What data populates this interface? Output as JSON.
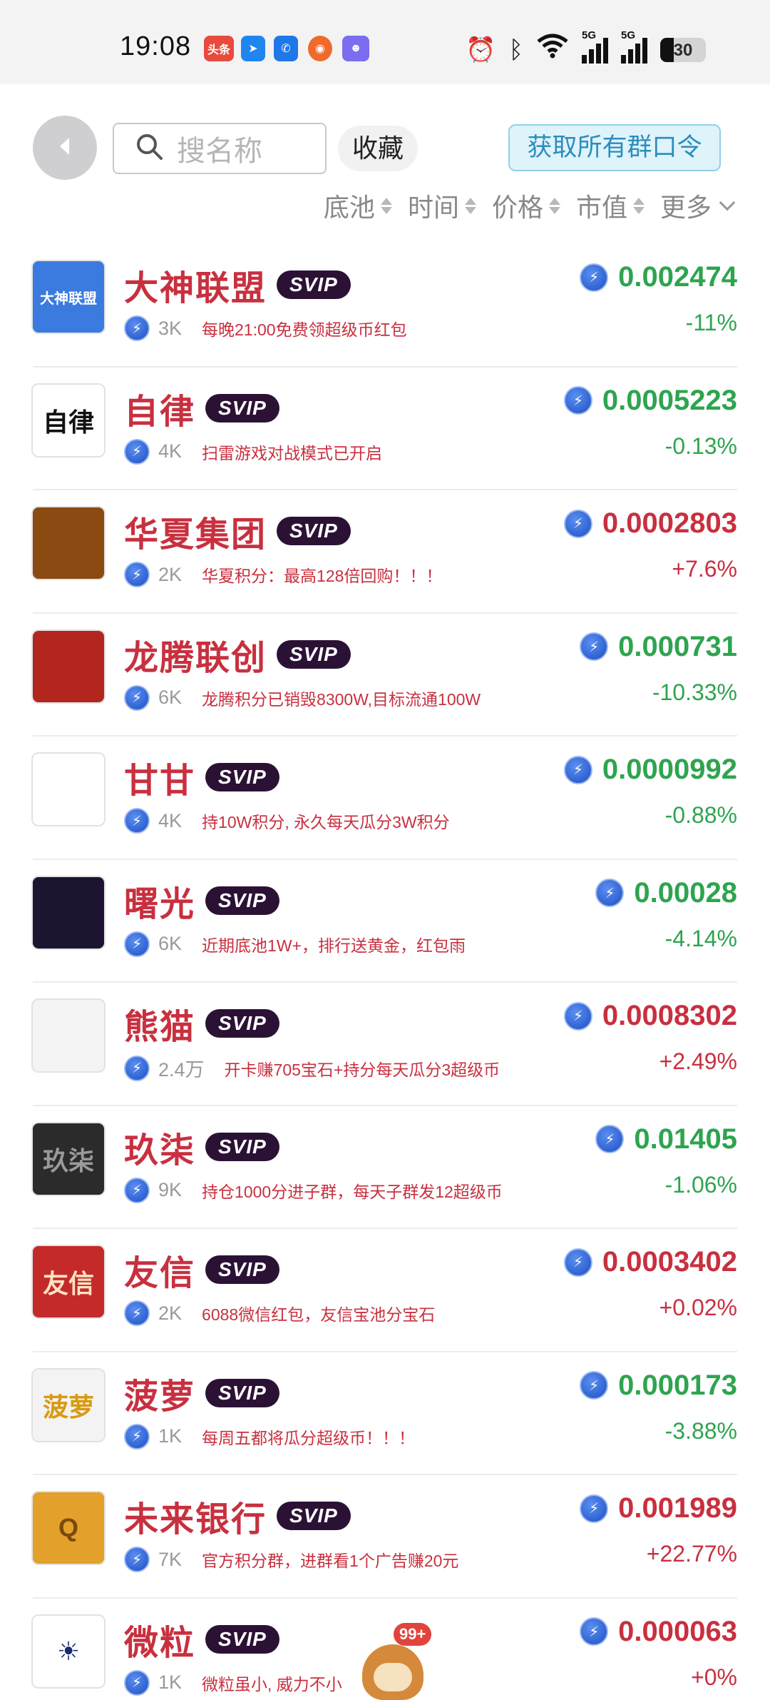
{
  "status_bar": {
    "time": "19:08",
    "apps": [
      {
        "name": "toutiao",
        "label": "头条",
        "color": "#e84a3c"
      },
      {
        "name": "arrow-app",
        "label": "",
        "color": "#1f86f0"
      },
      {
        "name": "phone-app",
        "label": "",
        "color": "#1f78e8"
      },
      {
        "name": "weibo-app",
        "label": "",
        "color": "#ef6a2b"
      },
      {
        "name": "mascot-app",
        "label": "",
        "color": "#7b6cf0"
      }
    ],
    "icons": [
      "alarm-icon",
      "bluetooth-icon",
      "wifi-icon"
    ],
    "signal_labels": [
      "5G",
      "5G"
    ],
    "battery": {
      "level": 0.3,
      "label": "30"
    }
  },
  "header": {
    "search_placeholder": "搜名称",
    "favorites_label": "收藏",
    "get_all_label": "获取所有群口令"
  },
  "sort": [
    {
      "label": "底池"
    },
    {
      "label": "时间"
    },
    {
      "label": "价格"
    },
    {
      "label": "市值"
    },
    {
      "label": "更多"
    }
  ],
  "svip_label": "SVIP",
  "groups": [
    {
      "name": "大神联盟",
      "members": "3K",
      "desc": "每晚21:00免费领超级币红包",
      "price": "0.002474",
      "change": "-11%",
      "trend": "down",
      "avatar_text": "大神联盟",
      "avatar_bg": "#3b7be0",
      "avatar_fg": "#ffffff"
    },
    {
      "name": "自律",
      "members": "4K",
      "desc": "扫雷游戏对战模式已开启",
      "price": "0.0005223",
      "change": "-0.13%",
      "trend": "down",
      "avatar_text": "自律",
      "avatar_bg": "#ffffff",
      "avatar_fg": "#111111"
    },
    {
      "name": "华夏集团",
      "members": "2K",
      "desc": "华夏积分：最高128倍回购！！！",
      "price": "0.0002803",
      "change": "+7.6%",
      "trend": "up",
      "avatar_text": "",
      "avatar_bg": "#8a4a12",
      "avatar_fg": "#ffd27a"
    },
    {
      "name": "龙腾联创",
      "members": "6K",
      "desc": "龙腾积分已销毁8300W,目标流通100W",
      "price": "0.000731",
      "change": "-10.33%",
      "trend": "down",
      "avatar_text": "",
      "avatar_bg": "#b3261e",
      "avatar_fg": "#f5c36b"
    },
    {
      "name": "甘甘",
      "members": "4K",
      "desc": "持10W积分, 永久每天瓜分3W积分",
      "price": "0.0000992",
      "change": "-0.88%",
      "trend": "down",
      "avatar_text": "",
      "avatar_bg": "#ffffff",
      "avatar_fg": "#9b4fe0"
    },
    {
      "name": "曙光",
      "members": "6K",
      "desc": "近期底池1W+，排行送黄金，红包雨",
      "price": "0.00028",
      "change": "-4.14%",
      "trend": "down",
      "avatar_text": "",
      "avatar_bg": "#1c1430",
      "avatar_fg": "#f3d16a"
    },
    {
      "name": "熊猫",
      "members": "2.4万",
      "desc": "开卡赚705宝石+持分每天瓜分3超级币",
      "price": "0.0008302",
      "change": "+2.49%",
      "trend": "up",
      "avatar_text": "",
      "avatar_bg": "#f4f4f4",
      "avatar_fg": "#111111"
    },
    {
      "name": "玖柒",
      "members": "9K",
      "desc": "持仓1000分进子群，每天子群发12超级币",
      "price": "0.01405",
      "change": "-1.06%",
      "trend": "down",
      "avatar_text": "玖柒",
      "avatar_bg": "#2b2b2b",
      "avatar_fg": "#9a9a9a"
    },
    {
      "name": "友信",
      "members": "2K",
      "desc": "6088微信红包，友信宝池分宝石",
      "price": "0.0003402",
      "change": "+0.02%",
      "trend": "up",
      "avatar_text": "友信",
      "avatar_bg": "#c42a2a",
      "avatar_fg": "#ffe2c4"
    },
    {
      "name": "菠萝",
      "members": "1K",
      "desc": "每周五都将瓜分超级币！！！",
      "price": "0.000173",
      "change": "-3.88%",
      "trend": "down",
      "avatar_text": "菠萝",
      "avatar_bg": "#f3f3f3",
      "avatar_fg": "#d89a12"
    },
    {
      "name": "未来银行",
      "members": "7K",
      "desc": "官方积分群，进群看1个广告赚20元",
      "price": "0.001989",
      "change": "+22.77%",
      "trend": "up",
      "avatar_text": "Q",
      "avatar_bg": "#e3a02a",
      "avatar_fg": "#7a4a0a"
    },
    {
      "name": "微粒",
      "members": "1K",
      "desc": "微粒虽小, 威力不小",
      "price": "0.000063",
      "change": "+0%",
      "trend": "up",
      "avatar_text": "☀",
      "avatar_bg": "#ffffff",
      "avatar_fg": "#1a2a6c"
    }
  ],
  "floating": {
    "badge": "99+"
  },
  "colors": {
    "up": "#c8303f",
    "down": "#2ea44f",
    "accent": "#2b8dbd"
  }
}
